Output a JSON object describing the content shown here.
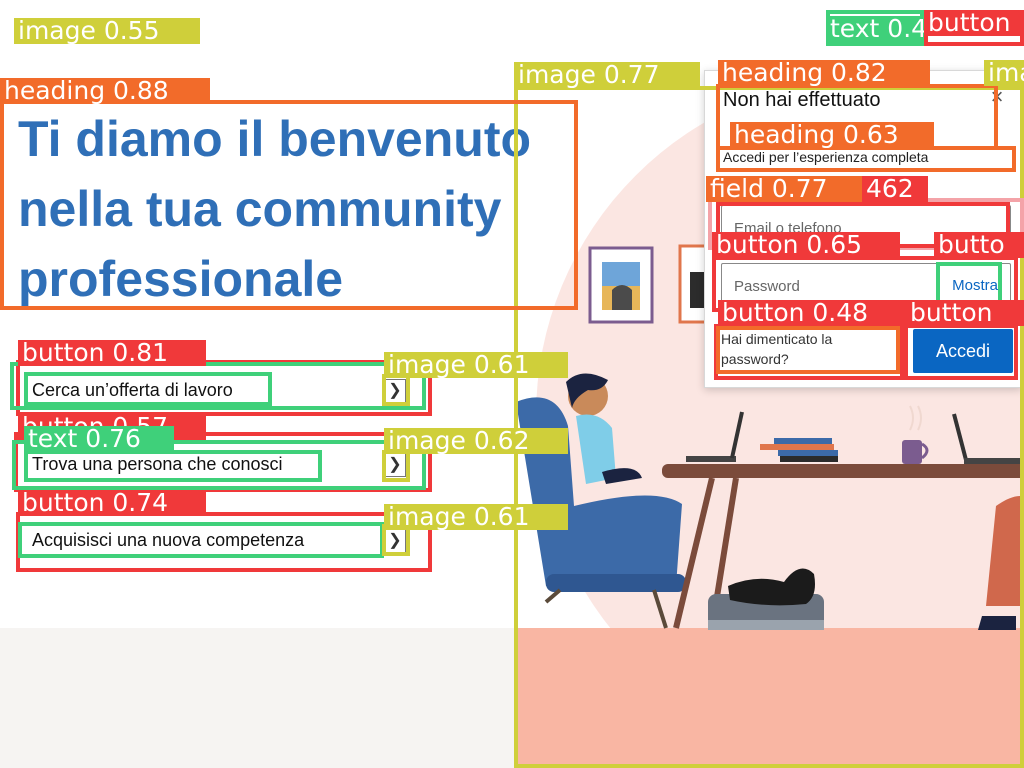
{
  "hero": {
    "title": "Ti diamo il benvenuto nella tua community professionale"
  },
  "options": [
    {
      "label": "Cerca un’offerta di lavoro"
    },
    {
      "label": "Trova una persona che conosci"
    },
    {
      "label": "Acquisisci una nuova competenza"
    }
  ],
  "login": {
    "title": "Non hai effettuato",
    "subtitle": "Accedi per l’esperienza completa",
    "email_placeholder": "Email o telefono",
    "password_placeholder": "Password",
    "show_label": "Mostra",
    "forgot_label": "Hai dimenticato la password?",
    "signin_label": "Accedi",
    "close_glyph": "×"
  },
  "overlay_labels": {
    "image_top_left": "image 0.55",
    "heading_hero": "heading 0.88",
    "image_illus": "image 0.77",
    "heading_card": "heading 0.82",
    "text_top": "text 0.4",
    "button_top": "button",
    "image_top_right": "ima",
    "heading_card_sub": "heading 0.63",
    "field_email": "field 0.77",
    "field_email_2": "462",
    "button_password": "button 0.65",
    "button_show": "butto",
    "button_forgot": "button 0.48",
    "button_signin": "button",
    "button_opt1": "button 0.81",
    "image_opt1": "image 0.61",
    "button_opt2": "button 0.57",
    "text_opt2": "text 0.76",
    "image_opt2": "image 0.62",
    "button_opt3": "button 0.74",
    "image_opt3": "image 0.61"
  },
  "colors": {
    "brand_blue": "#0a66c2",
    "hero_blue": "#2f6fb7",
    "blush": "#fbe6e2",
    "salmon": "#f9b6a3"
  },
  "icons": {
    "close": "close-icon",
    "chevron": "chevron-right-icon"
  },
  "chevron_glyph": "❯"
}
